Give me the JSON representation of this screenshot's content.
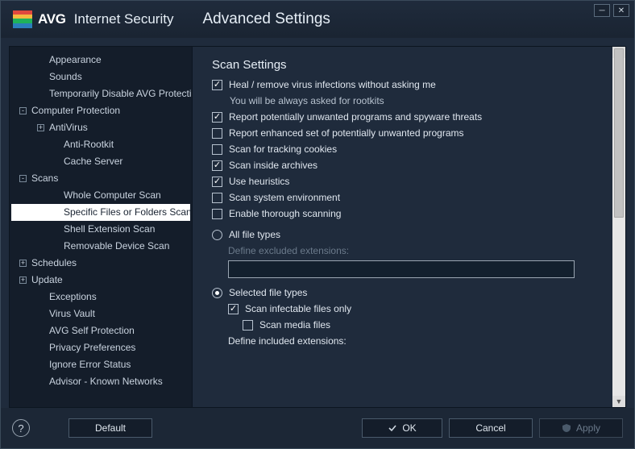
{
  "brand": {
    "name": "AVG",
    "suite": "Internet Security"
  },
  "header": {
    "title": "Advanced Settings"
  },
  "sidebar": {
    "items": [
      {
        "label": "Appearance",
        "level": 1,
        "toggle": null
      },
      {
        "label": "Sounds",
        "level": 1,
        "toggle": null
      },
      {
        "label": "Temporarily Disable AVG Protection",
        "level": 1,
        "toggle": null
      },
      {
        "label": "Computer Protection",
        "level": 0,
        "toggle": "-"
      },
      {
        "label": "AntiVirus",
        "level": 1,
        "toggle": "+"
      },
      {
        "label": "Anti-Rootkit",
        "level": 2,
        "toggle": null
      },
      {
        "label": "Cache Server",
        "level": 2,
        "toggle": null
      },
      {
        "label": "Scans",
        "level": 0,
        "toggle": "-"
      },
      {
        "label": "Whole Computer Scan",
        "level": 2,
        "toggle": null
      },
      {
        "label": "Specific Files or Folders Scan",
        "level": 2,
        "toggle": null,
        "selected": true
      },
      {
        "label": "Shell Extension Scan",
        "level": 2,
        "toggle": null
      },
      {
        "label": "Removable Device Scan",
        "level": 2,
        "toggle": null
      },
      {
        "label": "Schedules",
        "level": 0,
        "toggle": "+"
      },
      {
        "label": "Update",
        "level": 0,
        "toggle": "+"
      },
      {
        "label": "Exceptions",
        "level": 1,
        "toggle": null
      },
      {
        "label": "Virus Vault",
        "level": 1,
        "toggle": null
      },
      {
        "label": "AVG Self Protection",
        "level": 1,
        "toggle": null
      },
      {
        "label": "Privacy Preferences",
        "level": 1,
        "toggle": null
      },
      {
        "label": "Ignore Error Status",
        "level": 1,
        "toggle": null
      },
      {
        "label": "Advisor - Known Networks",
        "level": 1,
        "toggle": null
      }
    ]
  },
  "content": {
    "section_title": "Scan Settings",
    "checks": [
      {
        "label": "Heal / remove virus infections without asking me",
        "checked": true,
        "sub": "You will be always asked for rootkits"
      },
      {
        "label": "Report potentially unwanted programs and spyware threats",
        "checked": true
      },
      {
        "label": "Report enhanced set of potentially unwanted programs",
        "checked": false
      },
      {
        "label": "Scan for tracking cookies",
        "checked": false
      },
      {
        "label": "Scan inside archives",
        "checked": true
      },
      {
        "label": "Use heuristics",
        "checked": true
      },
      {
        "label": "Scan system environment",
        "checked": false
      },
      {
        "label": "Enable thorough scanning",
        "checked": false
      }
    ],
    "radio_all": {
      "label": "All file types",
      "selected": false,
      "define_label": "Define excluded extensions:",
      "value": ""
    },
    "radio_selected": {
      "label": "Selected file types",
      "selected": true,
      "sub_checks": [
        {
          "label": "Scan infectable files only",
          "checked": true
        },
        {
          "label": "Scan media files",
          "checked": false
        }
      ],
      "define_label": "Define included extensions:"
    }
  },
  "footer": {
    "help_tooltip": "Help",
    "default_label": "Default",
    "ok_label": "OK",
    "cancel_label": "Cancel",
    "apply_label": "Apply"
  }
}
